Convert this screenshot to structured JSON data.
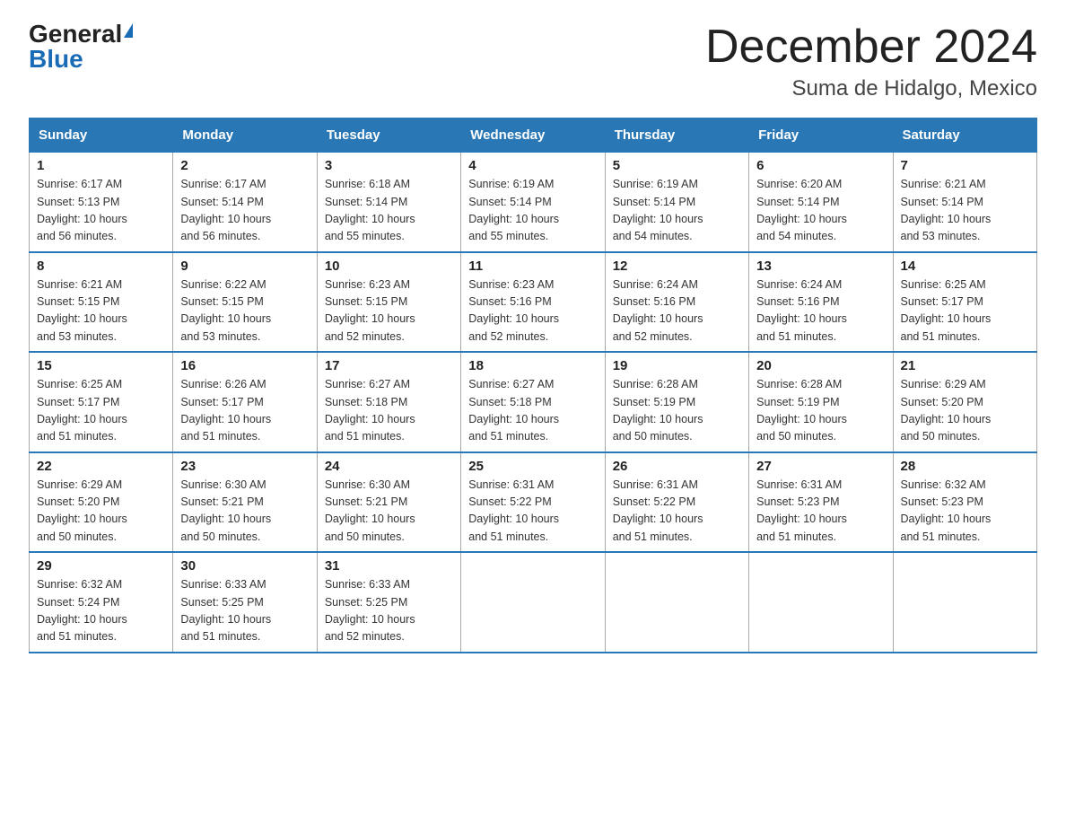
{
  "logo": {
    "general": "General",
    "blue": "Blue"
  },
  "title": "December 2024",
  "subtitle": "Suma de Hidalgo, Mexico",
  "days_of_week": [
    "Sunday",
    "Monday",
    "Tuesday",
    "Wednesday",
    "Thursday",
    "Friday",
    "Saturday"
  ],
  "weeks": [
    [
      {
        "day": "1",
        "info": "Sunrise: 6:17 AM\nSunset: 5:13 PM\nDaylight: 10 hours\nand 56 minutes."
      },
      {
        "day": "2",
        "info": "Sunrise: 6:17 AM\nSunset: 5:14 PM\nDaylight: 10 hours\nand 56 minutes."
      },
      {
        "day": "3",
        "info": "Sunrise: 6:18 AM\nSunset: 5:14 PM\nDaylight: 10 hours\nand 55 minutes."
      },
      {
        "day": "4",
        "info": "Sunrise: 6:19 AM\nSunset: 5:14 PM\nDaylight: 10 hours\nand 55 minutes."
      },
      {
        "day": "5",
        "info": "Sunrise: 6:19 AM\nSunset: 5:14 PM\nDaylight: 10 hours\nand 54 minutes."
      },
      {
        "day": "6",
        "info": "Sunrise: 6:20 AM\nSunset: 5:14 PM\nDaylight: 10 hours\nand 54 minutes."
      },
      {
        "day": "7",
        "info": "Sunrise: 6:21 AM\nSunset: 5:14 PM\nDaylight: 10 hours\nand 53 minutes."
      }
    ],
    [
      {
        "day": "8",
        "info": "Sunrise: 6:21 AM\nSunset: 5:15 PM\nDaylight: 10 hours\nand 53 minutes."
      },
      {
        "day": "9",
        "info": "Sunrise: 6:22 AM\nSunset: 5:15 PM\nDaylight: 10 hours\nand 53 minutes."
      },
      {
        "day": "10",
        "info": "Sunrise: 6:23 AM\nSunset: 5:15 PM\nDaylight: 10 hours\nand 52 minutes."
      },
      {
        "day": "11",
        "info": "Sunrise: 6:23 AM\nSunset: 5:16 PM\nDaylight: 10 hours\nand 52 minutes."
      },
      {
        "day": "12",
        "info": "Sunrise: 6:24 AM\nSunset: 5:16 PM\nDaylight: 10 hours\nand 52 minutes."
      },
      {
        "day": "13",
        "info": "Sunrise: 6:24 AM\nSunset: 5:16 PM\nDaylight: 10 hours\nand 51 minutes."
      },
      {
        "day": "14",
        "info": "Sunrise: 6:25 AM\nSunset: 5:17 PM\nDaylight: 10 hours\nand 51 minutes."
      }
    ],
    [
      {
        "day": "15",
        "info": "Sunrise: 6:25 AM\nSunset: 5:17 PM\nDaylight: 10 hours\nand 51 minutes."
      },
      {
        "day": "16",
        "info": "Sunrise: 6:26 AM\nSunset: 5:17 PM\nDaylight: 10 hours\nand 51 minutes."
      },
      {
        "day": "17",
        "info": "Sunrise: 6:27 AM\nSunset: 5:18 PM\nDaylight: 10 hours\nand 51 minutes."
      },
      {
        "day": "18",
        "info": "Sunrise: 6:27 AM\nSunset: 5:18 PM\nDaylight: 10 hours\nand 51 minutes."
      },
      {
        "day": "19",
        "info": "Sunrise: 6:28 AM\nSunset: 5:19 PM\nDaylight: 10 hours\nand 50 minutes."
      },
      {
        "day": "20",
        "info": "Sunrise: 6:28 AM\nSunset: 5:19 PM\nDaylight: 10 hours\nand 50 minutes."
      },
      {
        "day": "21",
        "info": "Sunrise: 6:29 AM\nSunset: 5:20 PM\nDaylight: 10 hours\nand 50 minutes."
      }
    ],
    [
      {
        "day": "22",
        "info": "Sunrise: 6:29 AM\nSunset: 5:20 PM\nDaylight: 10 hours\nand 50 minutes."
      },
      {
        "day": "23",
        "info": "Sunrise: 6:30 AM\nSunset: 5:21 PM\nDaylight: 10 hours\nand 50 minutes."
      },
      {
        "day": "24",
        "info": "Sunrise: 6:30 AM\nSunset: 5:21 PM\nDaylight: 10 hours\nand 50 minutes."
      },
      {
        "day": "25",
        "info": "Sunrise: 6:31 AM\nSunset: 5:22 PM\nDaylight: 10 hours\nand 51 minutes."
      },
      {
        "day": "26",
        "info": "Sunrise: 6:31 AM\nSunset: 5:22 PM\nDaylight: 10 hours\nand 51 minutes."
      },
      {
        "day": "27",
        "info": "Sunrise: 6:31 AM\nSunset: 5:23 PM\nDaylight: 10 hours\nand 51 minutes."
      },
      {
        "day": "28",
        "info": "Sunrise: 6:32 AM\nSunset: 5:23 PM\nDaylight: 10 hours\nand 51 minutes."
      }
    ],
    [
      {
        "day": "29",
        "info": "Sunrise: 6:32 AM\nSunset: 5:24 PM\nDaylight: 10 hours\nand 51 minutes."
      },
      {
        "day": "30",
        "info": "Sunrise: 6:33 AM\nSunset: 5:25 PM\nDaylight: 10 hours\nand 51 minutes."
      },
      {
        "day": "31",
        "info": "Sunrise: 6:33 AM\nSunset: 5:25 PM\nDaylight: 10 hours\nand 52 minutes."
      },
      {
        "day": "",
        "info": ""
      },
      {
        "day": "",
        "info": ""
      },
      {
        "day": "",
        "info": ""
      },
      {
        "day": "",
        "info": ""
      }
    ]
  ]
}
